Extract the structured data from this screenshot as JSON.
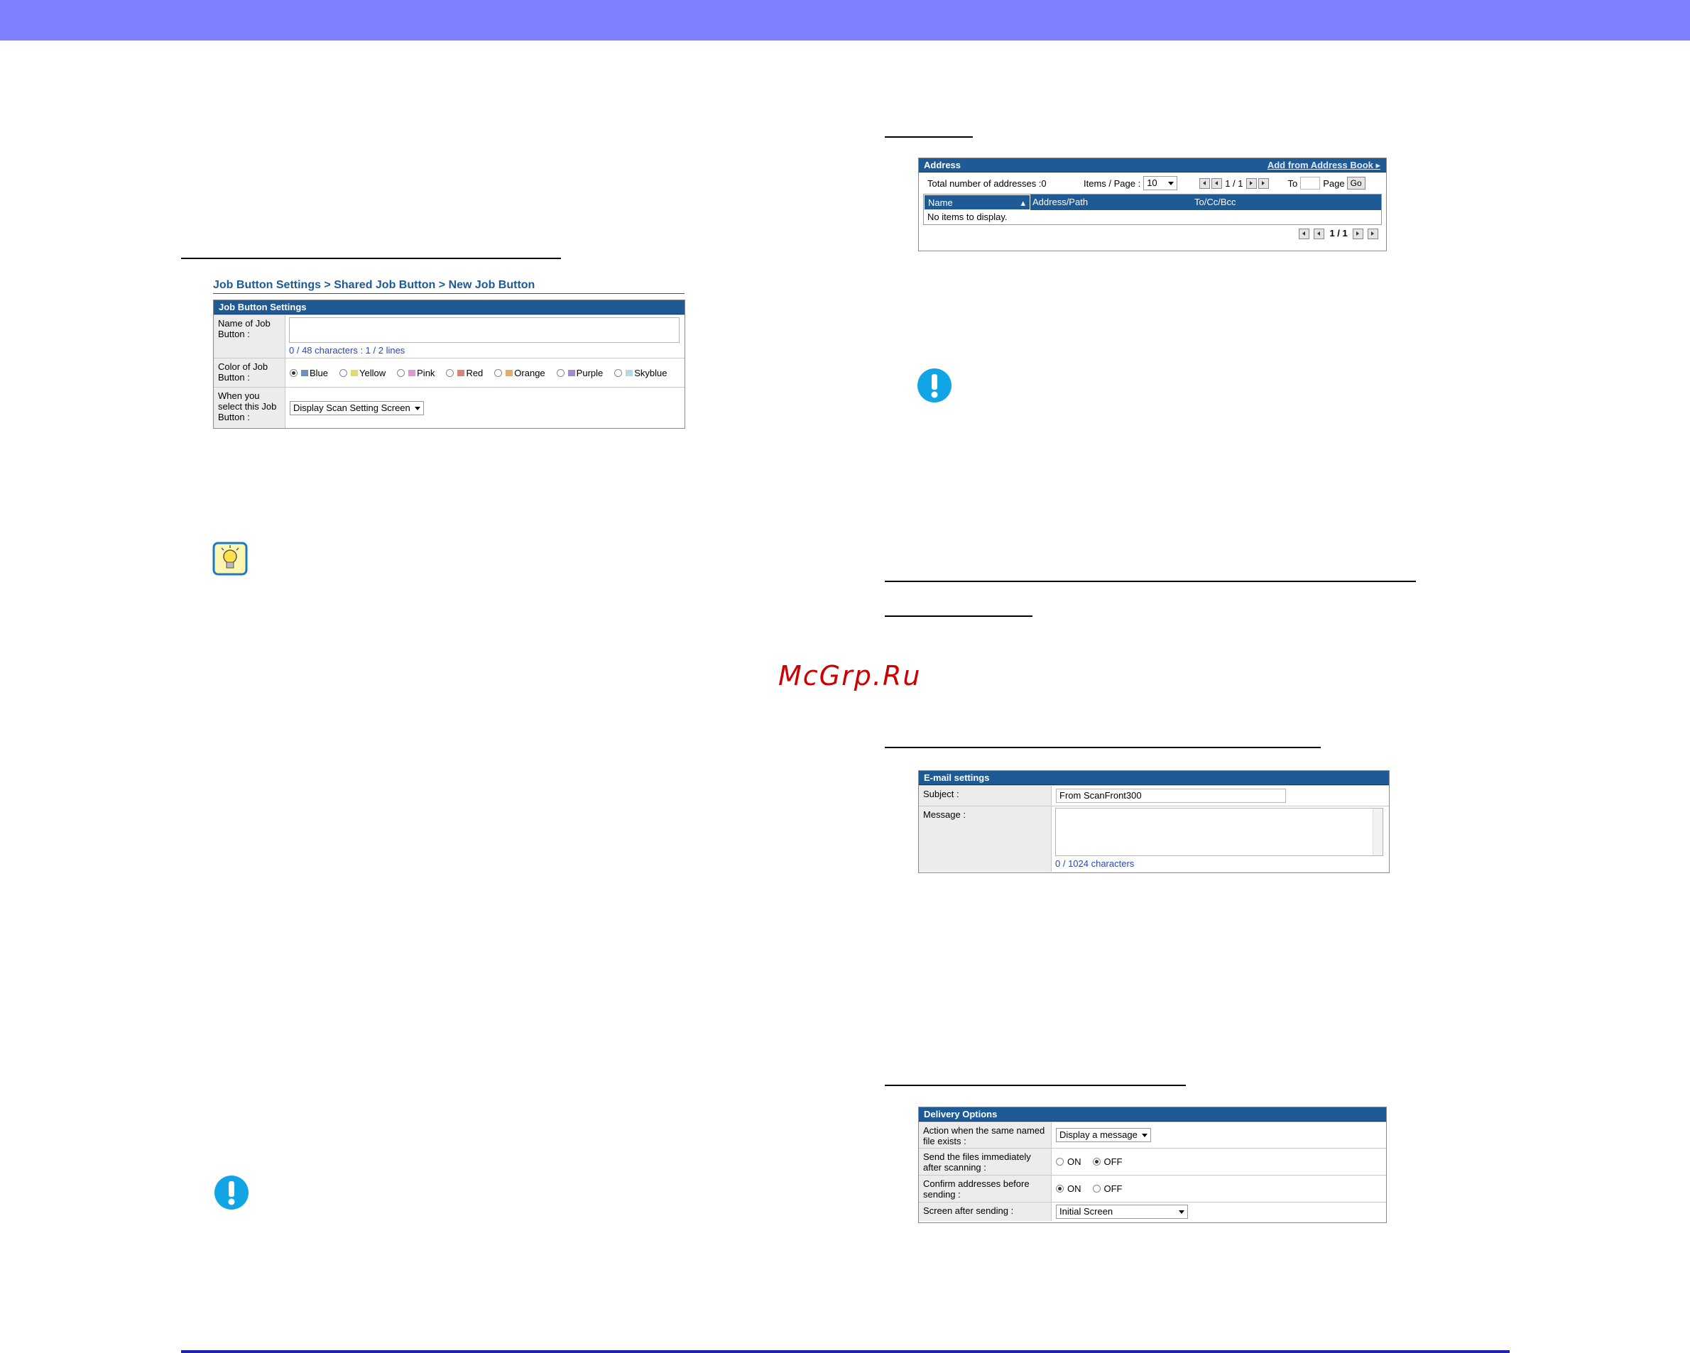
{
  "watermark": "McGrp.Ru",
  "job_panel": {
    "breadcrumb": "Job Button Settings > Shared Job Button > New Job Button",
    "header": "Job Button Settings",
    "name_label": "Name of Job Button :",
    "name_value": "",
    "name_counter": "0 / 48 characters : 1 / 2 lines",
    "color_label": "Color of Job Button :",
    "colors": [
      {
        "label": "Blue",
        "swatch": "#6f8fc0",
        "selected": true
      },
      {
        "label": "Yellow",
        "swatch": "#e6d96a",
        "selected": false
      },
      {
        "label": "Pink",
        "swatch": "#d99ad2",
        "selected": false
      },
      {
        "label": "Red",
        "swatch": "#de8080",
        "selected": false
      },
      {
        "label": "Orange",
        "swatch": "#e0b06a",
        "selected": false
      },
      {
        "label": "Purple",
        "swatch": "#a08ad0",
        "selected": false
      },
      {
        "label": "Skyblue",
        "swatch": "#b8d8e8",
        "selected": false
      }
    ],
    "select_label": "When you select this Job Button :",
    "select_value": "Display Scan Setting Screen"
  },
  "address_panel": {
    "header": "Address",
    "add_link": "Add from Address Book",
    "total_label": "Total number of addresses :0",
    "items_label": "Items / Page :",
    "items_value": "10",
    "page_indicator": "1 / 1",
    "to_label": "To",
    "page_label": "Page",
    "go_label": "Go",
    "columns": [
      "Name",
      "Address/Path",
      "To/Cc/Bcc"
    ],
    "empty_text": "No items to display.",
    "bottom_page_indicator": "1 / 1"
  },
  "email_panel": {
    "header": "E-mail settings",
    "subject_label": "Subject :",
    "subject_value": "From ScanFront300",
    "message_label": "Message :",
    "message_counter": "0 / 1024 characters"
  },
  "delivery_panel": {
    "header": "Delivery Options",
    "rows": [
      {
        "label": "Action when the same named file exists :",
        "type": "select",
        "value": "Display a message"
      },
      {
        "label": "Send the files immediately after scanning :",
        "type": "radio",
        "on_label": "ON",
        "off_label": "OFF",
        "selected": "off"
      },
      {
        "label": "Confirm addresses before sending :",
        "type": "radio",
        "on_label": "ON",
        "off_label": "OFF",
        "selected": "on"
      },
      {
        "label": "Screen after sending :",
        "type": "select",
        "value": "Initial Screen"
      }
    ]
  }
}
